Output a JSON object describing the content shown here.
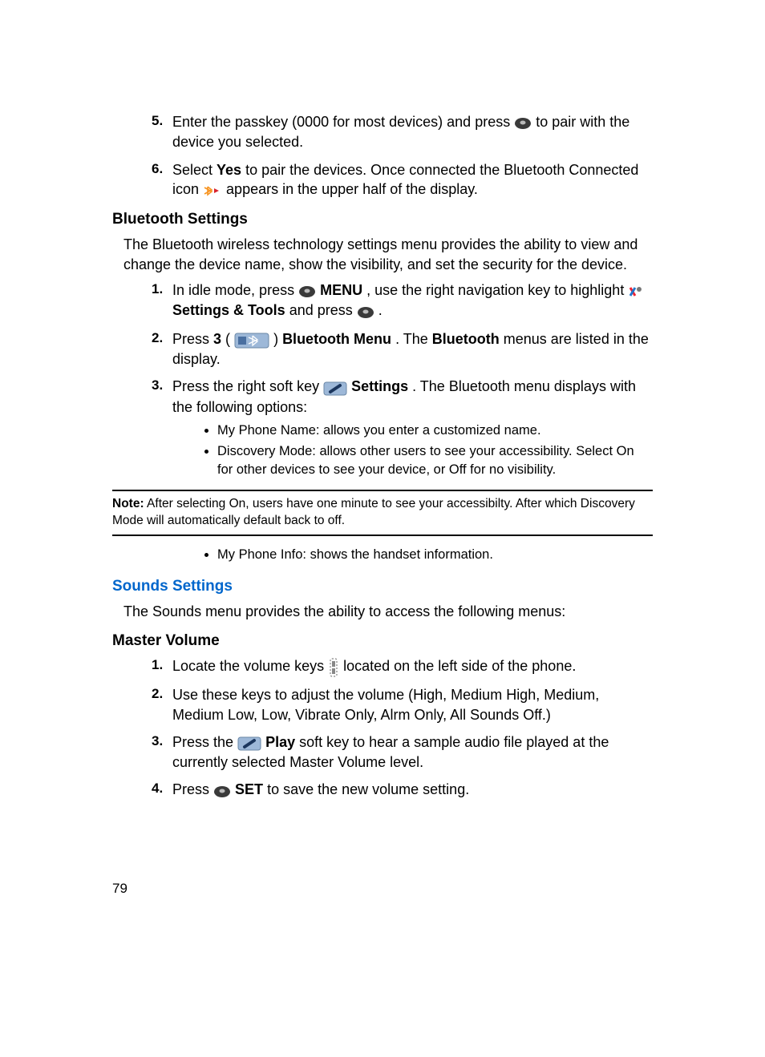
{
  "page_number": "79",
  "top_list": {
    "5": {
      "num": "5.",
      "pre": "Enter the passkey (0000 for most devices) and press ",
      "post": " to pair with the device you selected."
    },
    "6": {
      "num": "6.",
      "pre": "Select ",
      "yes": "Yes",
      "mid": " to pair the devices. Once connected the Bluetooth Connected icon ",
      "post": " appears in the upper half of the display."
    }
  },
  "bt_settings": {
    "heading": "Bluetooth Settings",
    "intro": "The Bluetooth wireless technology settings menu provides the ability to view and change the device name, show the visibility, and set the security for the device.",
    "steps": {
      "1": {
        "num": "1.",
        "a": "In idle mode, press ",
        "menu": "MENU",
        "b": ", use the right navigation key to highlight ",
        "tools": "Settings & Tools",
        "c": " and press ",
        "d": "."
      },
      "2": {
        "num": "2.",
        "a": "Press ",
        "three": "3",
        "b": " ( ",
        "c": " ) ",
        "btmenu": "Bluetooth Menu",
        "d": ". The ",
        "bt": "Bluetooth",
        "e": " menus are listed in the display."
      },
      "3": {
        "num": "3.",
        "a": "Press the right soft key ",
        "settings": "Settings",
        "b": ". The Bluetooth menu displays with the following options:",
        "bullets": [
          "My Phone Name: allows you enter a customized name.",
          "Discovery Mode: allows other users to see your accessibility. Select On for other devices to see your device, or Off for no visibility."
        ]
      }
    },
    "note_bold": "Note:",
    "note_text": " After selecting On, users have one minute to see your accessibilty.  After which Discovery Mode will automatically default back to off.",
    "post_bullets": [
      "My Phone Info: shows the handset information."
    ]
  },
  "sounds": {
    "heading": "Sounds Settings",
    "intro": "The Sounds menu provides the ability to access the following menus:"
  },
  "master_volume": {
    "heading": "Master Volume",
    "steps": {
      "1": {
        "num": "1.",
        "a": "Locate the volume keys ",
        "b": " located on the left side of the phone."
      },
      "2": {
        "num": "2.",
        "a": "Use these keys to adjust the volume (High, Medium High, Medium, Medium Low, Low, Vibrate Only, Alrm Only, All Sounds Off.)"
      },
      "3": {
        "num": "3.",
        "a": "Press the ",
        "play": "Play",
        "b": " soft key to hear a sample audio file played at the currently selected Master Volume level."
      },
      "4": {
        "num": "4.",
        "a": "Press ",
        "set": "SET",
        "b": " to save the new volume setting."
      }
    }
  }
}
